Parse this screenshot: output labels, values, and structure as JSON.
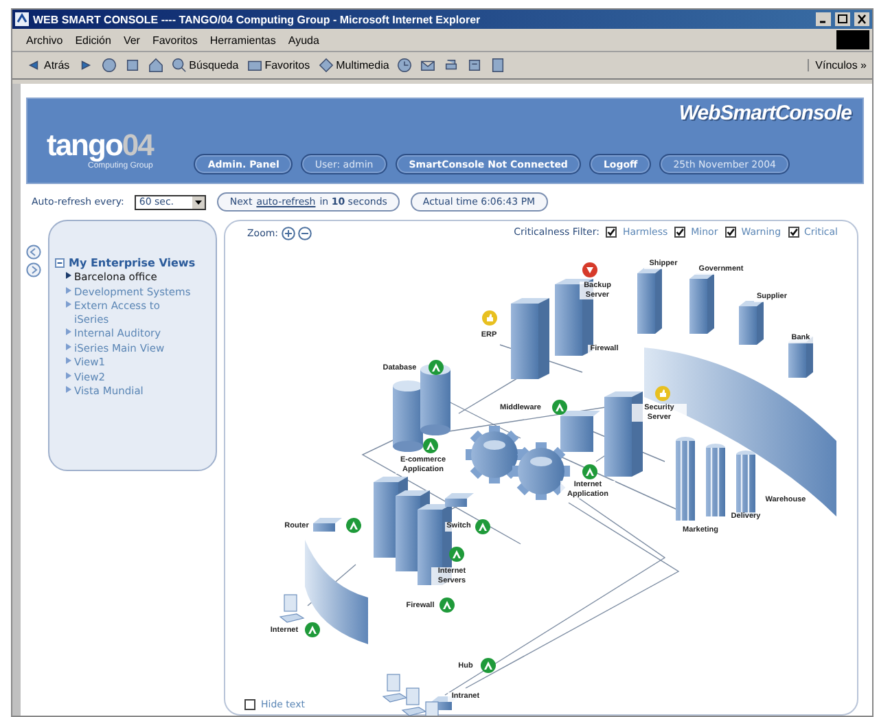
{
  "window": {
    "title": "WEB SMART CONSOLE ---- TANGO/04 Computing Group - Microsoft Internet Explorer"
  },
  "menu": [
    "Archivo",
    "Edición",
    "Ver",
    "Favoritos",
    "Herramientas",
    "Ayuda"
  ],
  "toolbar": [
    {
      "kind": "back",
      "label": "Atrás"
    },
    {
      "kind": "forward"
    },
    {
      "kind": "stop"
    },
    {
      "kind": "refresh"
    },
    {
      "kind": "home"
    },
    {
      "kind": "search",
      "label": "Búsqueda"
    },
    {
      "kind": "favorites",
      "label": "Favoritos"
    },
    {
      "kind": "media",
      "label": "Multimedia"
    },
    {
      "kind": "history"
    },
    {
      "kind": "mail"
    },
    {
      "kind": "print"
    },
    {
      "kind": "edit"
    },
    {
      "kind": "discuss"
    }
  ],
  "links_label": "Vínculos »",
  "header": {
    "logo": {
      "name": "tango",
      "number": "04",
      "tagline": "Computing Group"
    },
    "product": "WebSmartConsole",
    "items": [
      {
        "kind": "button",
        "label": "Admin. Panel"
      },
      {
        "kind": "info",
        "label": "User: admin"
      },
      {
        "kind": "button",
        "label": "SmartConsole Not Connected"
      },
      {
        "kind": "button",
        "label": "Logoff"
      },
      {
        "kind": "info",
        "label": "25th November 2004"
      }
    ]
  },
  "refresh": {
    "label": "Auto-refresh every:",
    "value": "60 sec.",
    "next_prefix": "Next",
    "next_link": "auto-refresh",
    "next_suffix": "in **10** seconds",
    "time": "Actual time 6:06:43 PM"
  },
  "tree": {
    "label": "My Enterprise Views",
    "expanded": true,
    "children": [
      {
        "label": "Barcelona office",
        "selected": true
      },
      {
        "label": "Development Systems",
        "selected": false
      },
      {
        "label": "Extern Access to iSeries",
        "selected": false
      },
      {
        "label": "Internal Auditory",
        "selected": false
      },
      {
        "label": "iSeries Main View",
        "selected": false
      },
      {
        "label": "View1",
        "selected": false
      },
      {
        "label": "View2",
        "selected": false
      },
      {
        "label": "Vista Mundial",
        "selected": false
      }
    ]
  },
  "zoom_label": "Zoom:",
  "filter": {
    "label": "Criticalness Filter:",
    "options": [
      {
        "label": "Harmless",
        "checked": true
      },
      {
        "label": "Minor",
        "checked": true
      },
      {
        "label": "Warning",
        "checked": true
      },
      {
        "label": "Critical",
        "checked": true
      }
    ]
  },
  "nodes": [
    {
      "label": "Backup Server",
      "kind": "critical",
      "color": "#d63a2a"
    },
    {
      "label": "ERP",
      "kind": "warning",
      "color": "#e8c020"
    },
    {
      "label": "Shipper",
      "kind": "plain"
    },
    {
      "label": "Government",
      "kind": "plain"
    },
    {
      "label": "Supplier",
      "kind": "plain"
    },
    {
      "label": "Bank",
      "kind": "plain"
    },
    {
      "label": "Firewall",
      "kind": "plain"
    },
    {
      "label": "Database",
      "kind": "harmless",
      "color": "#1f9a3a"
    },
    {
      "label": "Middleware",
      "kind": "harmless",
      "color": "#1f9a3a"
    },
    {
      "label": "Security Server",
      "kind": "warning",
      "color": "#e8c020"
    },
    {
      "label": "E-commerce Application",
      "kind": "harmless",
      "color": "#1f9a3a"
    },
    {
      "label": "Internet Application",
      "kind": "harmless",
      "color": "#1f9a3a"
    },
    {
      "label": "Warehouse",
      "kind": "plain"
    },
    {
      "label": "Delivery",
      "kind": "plain"
    },
    {
      "label": "Marketing",
      "kind": "plain"
    },
    {
      "label": "Switch",
      "kind": "harmless",
      "color": "#1f9a3a"
    },
    {
      "label": "Router",
      "kind": "harmless",
      "color": "#1f9a3a"
    },
    {
      "label": "Internet Servers",
      "kind": "harmless",
      "color": "#1f9a3a"
    },
    {
      "label": "Firewall",
      "kind": "harmless",
      "color": "#1f9a3a"
    },
    {
      "label": "Internet",
      "kind": "harmless",
      "color": "#1f9a3a"
    },
    {
      "label": "Hub",
      "kind": "harmless",
      "color": "#1f9a3a"
    },
    {
      "label": "Intranet",
      "kind": "plain"
    }
  ],
  "hide_text": {
    "label": "Hide text",
    "checked": false
  }
}
